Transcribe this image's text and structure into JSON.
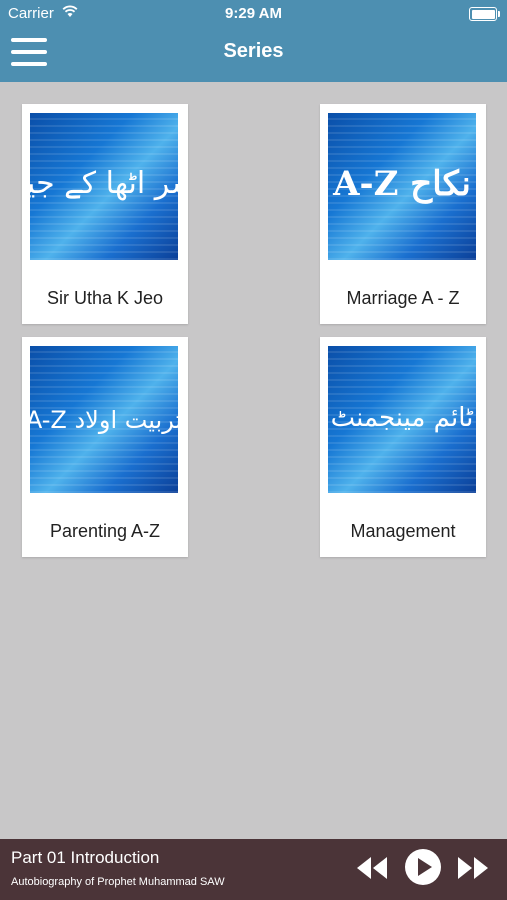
{
  "status_bar": {
    "carrier": "Carrier",
    "time": "9:29 AM"
  },
  "header": {
    "title": "Series"
  },
  "series": [
    {
      "label": "Sir Utha K Jeo",
      "thumb_text": "سر اٹھا کے جیو"
    },
    {
      "label": "Marriage A - Z",
      "thumb_text": "نکاح A-Z"
    },
    {
      "label": "Parenting A-Z",
      "thumb_text": "تربیت اولاد A-Z"
    },
    {
      "label": "Management",
      "thumb_text": "ٹائم مینجمنٹ"
    }
  ],
  "player": {
    "title": "Part 01 Introduction",
    "subtitle": "Autobiography of Prophet Muhammad SAW"
  }
}
